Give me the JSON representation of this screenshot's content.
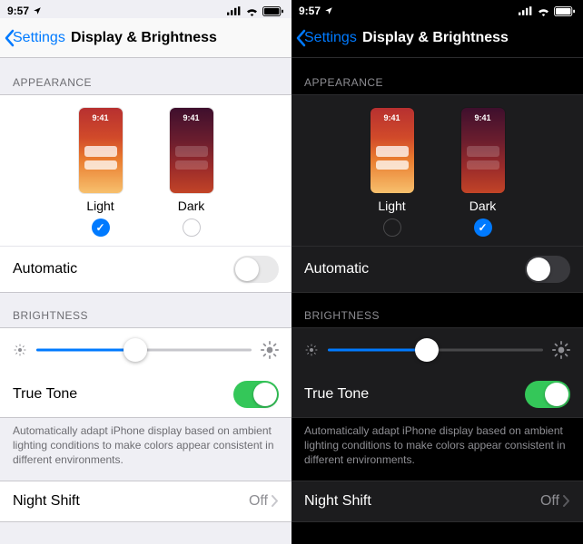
{
  "status": {
    "time": "9:57"
  },
  "nav": {
    "back": "Settings",
    "title": "Display & Brightness"
  },
  "sections": {
    "appearance": {
      "header": "APPEARANCE",
      "light_label": "Light",
      "dark_label": "Dark",
      "thumb_clock": "9:41",
      "automatic_label": "Automatic"
    },
    "brightness": {
      "header": "BRIGHTNESS",
      "true_tone_label": "True Tone",
      "true_tone_footer": "Automatically adapt iPhone display based on ambient lighting conditions to make colors appear consistent in different environments."
    },
    "night_shift": {
      "label": "Night Shift",
      "value": "Off"
    }
  },
  "left_pane": {
    "selected_appearance": "light",
    "automatic_on": false,
    "brightness_pct": 46,
    "true_tone_on": true
  },
  "right_pane": {
    "selected_appearance": "dark",
    "automatic_on": false,
    "brightness_pct": 46,
    "true_tone_on": true
  }
}
